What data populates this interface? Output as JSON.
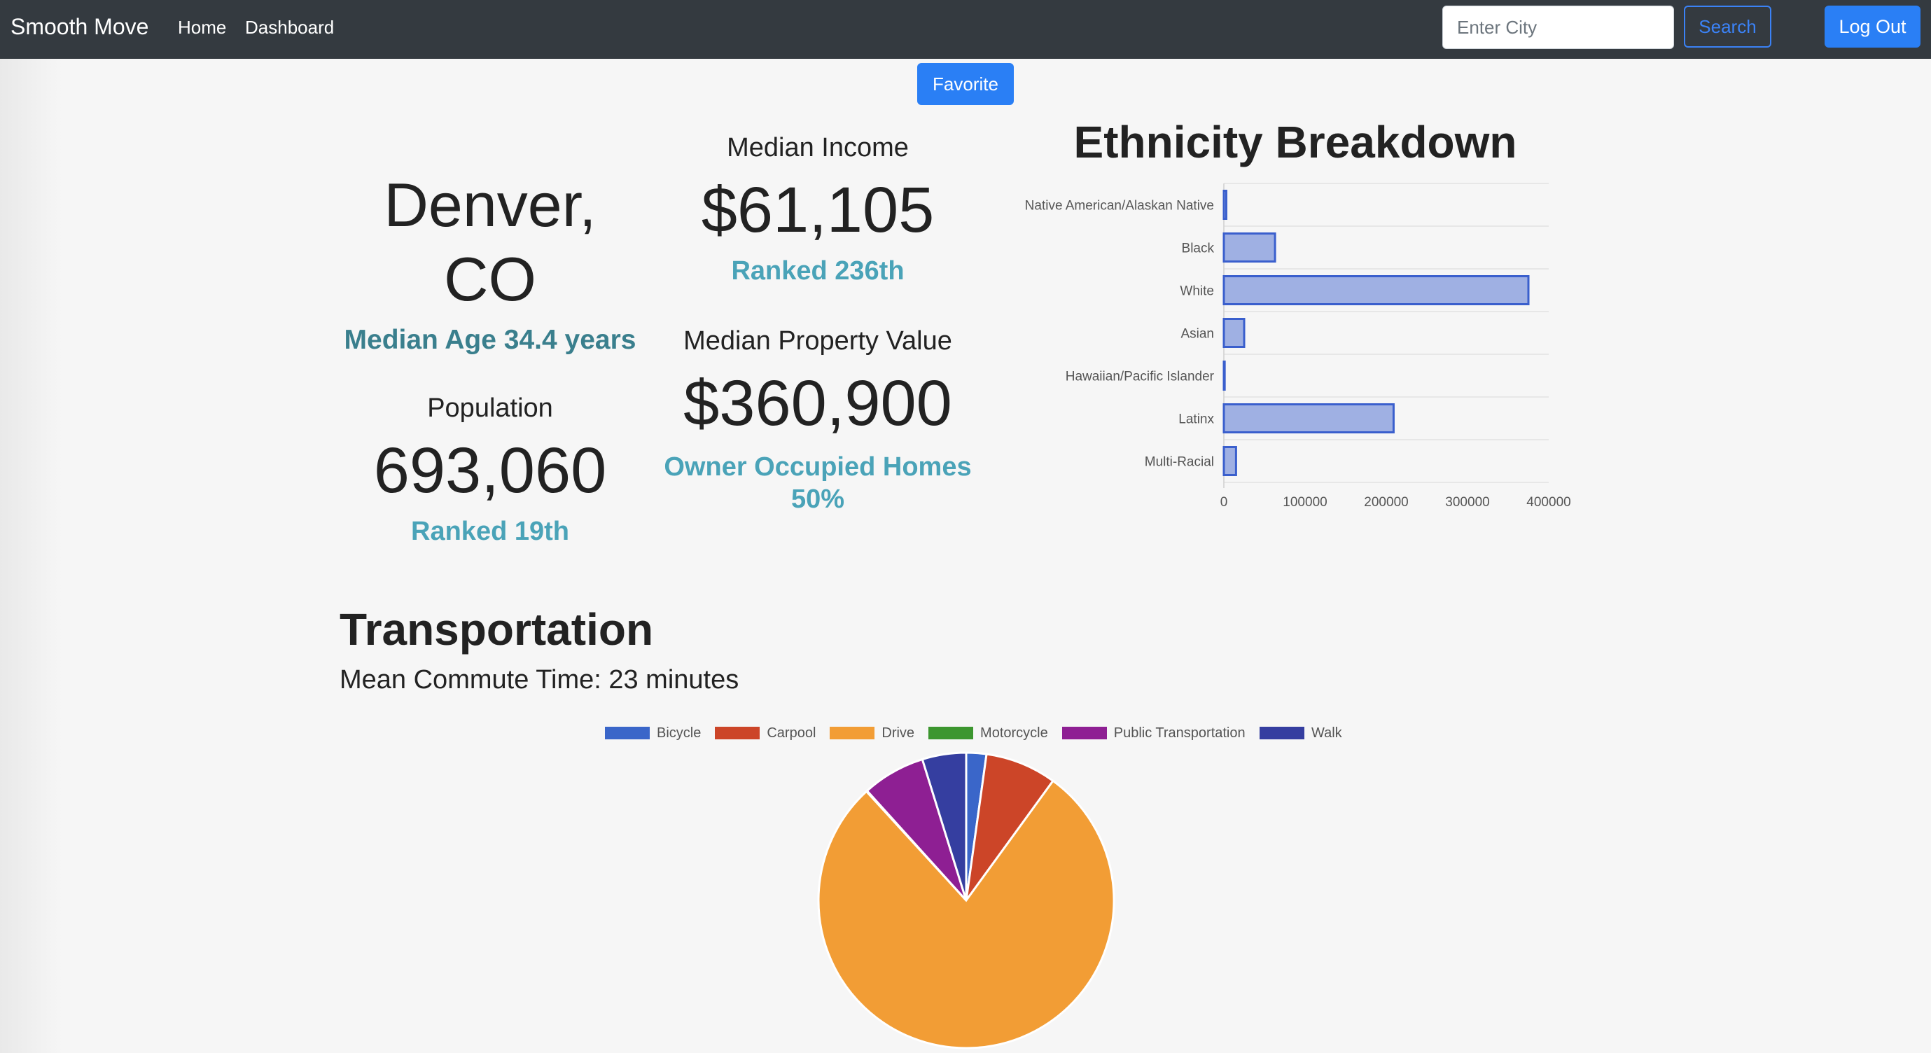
{
  "navbar": {
    "brand": "Smooth Move",
    "links": [
      "Home",
      "Dashboard"
    ],
    "search_placeholder": "Enter City",
    "search_label": "Search",
    "logout_label": "Log Out"
  },
  "favorite_label": "Favorite",
  "city": {
    "name_line1": "Denver,",
    "name_line2": "CO",
    "median_age": "Median Age 34.4 years"
  },
  "population": {
    "label": "Population",
    "value": "693,060",
    "rank": "Ranked 19th"
  },
  "income": {
    "label": "Median Income",
    "value": "$61,105",
    "rank": "Ranked 236th"
  },
  "property": {
    "label": "Median Property Value",
    "value": "$360,900",
    "owner_line1": "Owner Occupied Homes",
    "owner_line2": "50%"
  },
  "ethnicity": {
    "title": "Ethnicity Breakdown"
  },
  "transportation": {
    "title": "Transportation",
    "commute": "Mean Commute Time: 23 minutes"
  },
  "colors": {
    "primary": "#2a7ff5",
    "navbar": "#343a40",
    "teal": "#4aa3b8",
    "bar_fill": "#9fb0e3",
    "bar_stroke": "#3a5fcd"
  },
  "chart_data": [
    {
      "type": "bar",
      "orientation": "horizontal",
      "categories": [
        "Native American/Alaskan Native",
        "Black",
        "White",
        "Asian",
        "Hawaiian/Pacific Islander",
        "Latinx",
        "Multi-Racial"
      ],
      "values": [
        3000,
        63000,
        375000,
        25000,
        1000,
        209000,
        15000
      ],
      "xlim": [
        0,
        400000
      ],
      "xticks": [
        "0",
        "100000",
        "200000",
        "300000",
        "400000"
      ],
      "grid": true
    },
    {
      "type": "pie",
      "categories": [
        "Bicycle",
        "Carpool",
        "Drive",
        "Motorcycle",
        "Public Transportation",
        "Walk"
      ],
      "values": [
        2.2,
        7.8,
        78.2,
        0.1,
        6.9,
        4.8
      ],
      "colors": [
        "#3a66c9",
        "#cc4528",
        "#f29d35",
        "#3c962f",
        "#8e1f93",
        "#353ea0"
      ],
      "legend": "top"
    }
  ]
}
